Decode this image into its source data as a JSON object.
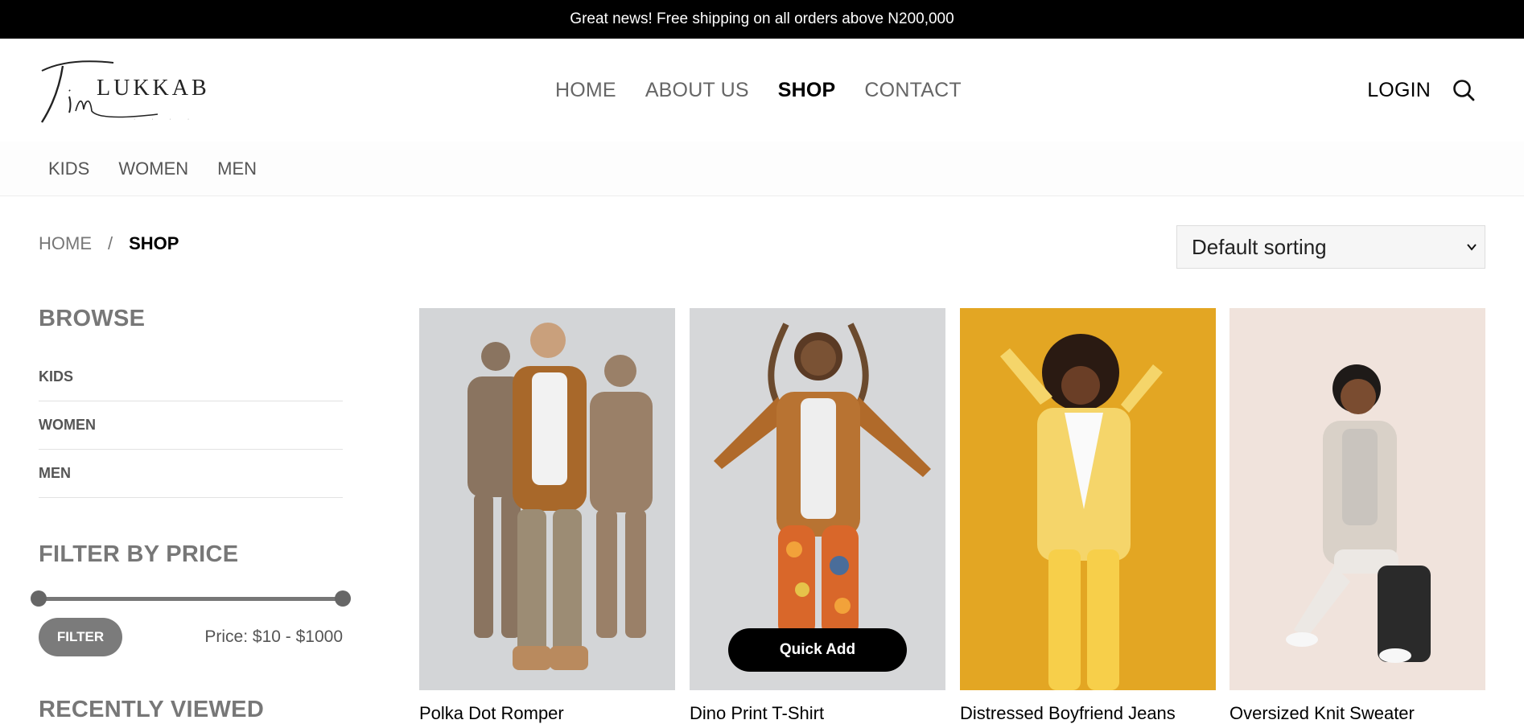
{
  "announcement": "Great news! Free shipping on all orders above N200,000",
  "logo_text": "TimLUKKAB",
  "main_nav": [
    {
      "label": "HOME",
      "active": false
    },
    {
      "label": "ABOUT US",
      "active": false
    },
    {
      "label": "SHOP",
      "active": true
    },
    {
      "label": "CONTACT",
      "active": false
    }
  ],
  "header_actions": {
    "login_label": "LOGIN",
    "search_icon": "search-icon"
  },
  "sub_nav": [
    "KIDS",
    "WOMEN",
    "MEN"
  ],
  "breadcrumb": {
    "home": "HOME",
    "separator": "/",
    "current": "SHOP"
  },
  "sorting": {
    "selected": "Default sorting"
  },
  "sidebar": {
    "browse_heading": "BROWSE",
    "categories": [
      "KIDS",
      "WOMEN",
      "MEN"
    ],
    "filter_heading": "FILTER BY PRICE",
    "filter_button": "FILTER",
    "price_label": "Price: $10 - $1000",
    "recently_viewed_heading": "RECENTLY VIEWED"
  },
  "products": [
    {
      "title": "Polka Dot Romper",
      "bg": "#d4d6d8"
    },
    {
      "title": "Dino Print T-Shirt",
      "bg": "#d6d7d9",
      "quick_add": "Quick Add"
    },
    {
      "title": "Distressed Boyfriend Jeans",
      "bg": "#e3a623"
    },
    {
      "title": "Oversized Knit Sweater",
      "bg": "#f0e3dc"
    }
  ],
  "colors": {
    "announcement_bg": "#000000",
    "button_gray": "#7b7b7b",
    "accent": "#000000"
  }
}
